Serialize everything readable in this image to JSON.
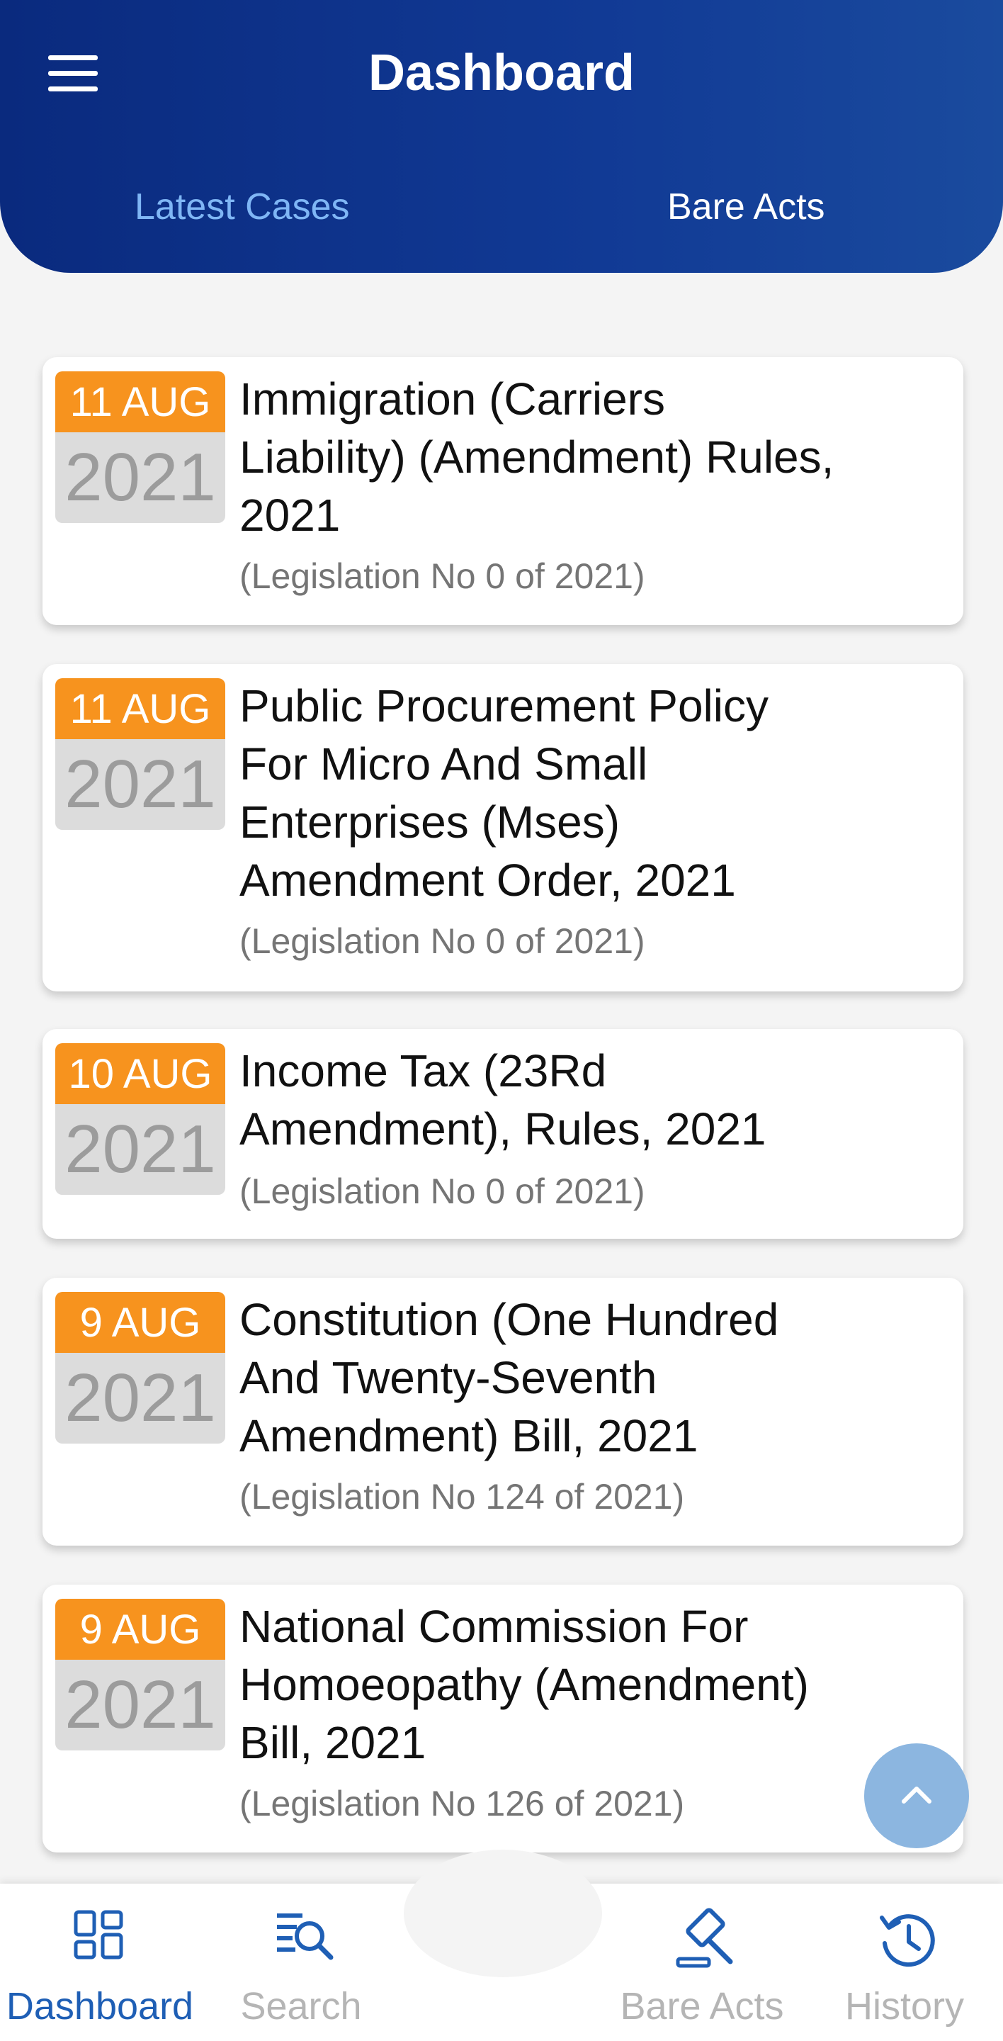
{
  "header": {
    "title": "Dashboard",
    "tabs": [
      {
        "label": "Latest Cases",
        "active": true
      },
      {
        "label": "Bare Acts",
        "active": false
      }
    ]
  },
  "cases": [
    {
      "day": "11 AUG",
      "year": "2021",
      "title_lines": [
        "Immigration (Carriers",
        "Liability) (Amendment) Rules,",
        "2021"
      ],
      "subtitle": "(Legislation No 0 of 2021)"
    },
    {
      "day": "11 AUG",
      "year": "2021",
      "title_lines": [
        "Public Procurement Policy",
        "For Micro And Small",
        "Enterprises (Mses)",
        "Amendment Order, 2021"
      ],
      "subtitle": "(Legislation No 0 of 2021)"
    },
    {
      "day": "10 AUG",
      "year": "2021",
      "title_lines": [
        "Income Tax (23Rd",
        "Amendment), Rules, 2021"
      ],
      "subtitle": "(Legislation No 0 of 2021)"
    },
    {
      "day": "9 AUG",
      "year": "2021",
      "title_lines": [
        "Constitution (One Hundred",
        "And Twenty-Seventh",
        "Amendment) Bill, 2021"
      ],
      "subtitle": "(Legislation No 124 of 2021)"
    },
    {
      "day": "9 AUG",
      "year": "2021",
      "title_lines": [
        "National Commission For",
        "Homoeopathy (Amendment)",
        "Bill, 2021"
      ],
      "subtitle": "(Legislation No 126 of 2021)"
    }
  ],
  "bottom_nav": [
    {
      "label": "Dashboard",
      "icon": "dashboard-icon",
      "active": true
    },
    {
      "label": "Search",
      "icon": "search-icon",
      "active": false
    },
    {
      "label": "Bare Acts",
      "icon": "gavel-icon",
      "active": false
    },
    {
      "label": "History",
      "icon": "history-icon",
      "active": false
    }
  ],
  "colors": {
    "header": "#0a2a7e",
    "date_badge": "#f7931e",
    "active_tab": "#7fb6f5",
    "active_nav": "#1f5fb5"
  }
}
